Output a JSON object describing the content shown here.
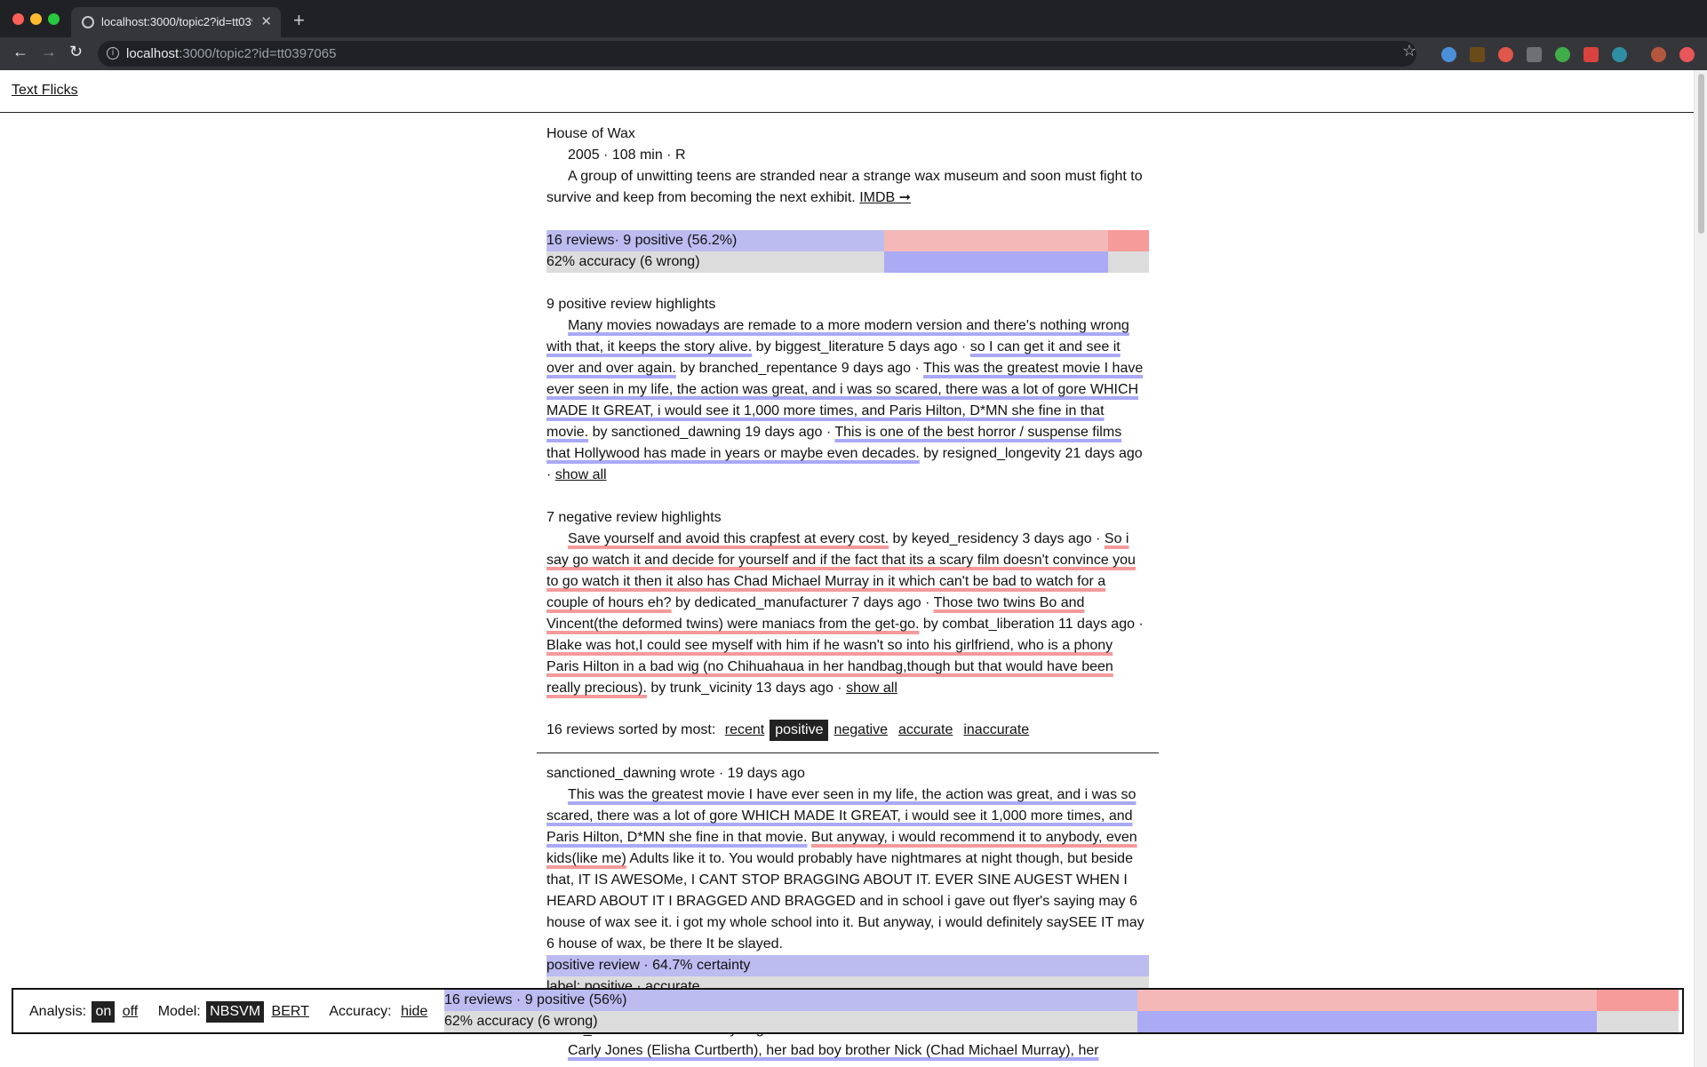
{
  "browser": {
    "tab_title": "localhost:3000/topic2?id=tt0397065",
    "url_host": "localhost",
    "url_rest": ":3000/topic2?id=tt0397065"
  },
  "site": {
    "brand": "Text Flicks"
  },
  "movie": {
    "title": "House of Wax",
    "meta": "2005 · 108 min · R",
    "synopsis": "A group of unwitting teens are stranded near a strange wax museum and soon must fight to survive and keep from becoming the next exhibit.",
    "imdb_link": "IMDB ➞"
  },
  "summary": {
    "reviews_line": "16 reviews· 9 positive (56.2%)",
    "accuracy_line": "62% accuracy (6 wrong)",
    "positive_share": 0.562,
    "accuracy": 0.62
  },
  "positive_highlights": {
    "heading": "9 positive review highlights",
    "items": [
      {
        "text": "Many movies nowadays are remade to a more modern version and there's nothing wrong with that, it keeps the story alive.",
        "byline": "by biggest_literature 5 days ago"
      },
      {
        "text": "so I can get it and see it over and over again.",
        "byline": "by branched_repentance 9 days ago"
      },
      {
        "text": "This was the greatest movie I have ever seen in my life, the action was great, and i was so scared, there was a lot of gore WHICH MADE It GREAT, i would see it 1,000 more times, and Paris Hilton, D*MN she fine in that movie.",
        "byline": "by sanctioned_dawning 19 days ago"
      },
      {
        "text": "This is one of the best horror / suspense films that Hollywood has made in years or maybe even decades.",
        "byline": "by resigned_longevity 21 days ago"
      }
    ],
    "show_all": "show all"
  },
  "negative_highlights": {
    "heading": "7 negative review highlights",
    "items": [
      {
        "text": "Save yourself and avoid this crapfest at every cost.",
        "byline": "by keyed_residency 3 days ago"
      },
      {
        "text": "So i say go watch it and decide for yourself and if the fact that its a scary film doesn't convince you to go watch it then it also has Chad Michael Murray in it which can't be bad to watch for a couple of hours eh?",
        "byline": "by dedicated_manufacturer 7 days ago"
      },
      {
        "text": "Those two twins Bo and Vincent(the deformed twins) were maniacs from the get-go.",
        "byline": "by combat_liberation 11 days ago"
      },
      {
        "text": "Blake was hot,I could see myself with him if he wasn't so into his girlfriend, who is a phony Paris Hilton in a bad wig (no Chihuahaua in her handbag,though but that would have been really precious).",
        "byline": "by trunk_vicinity 13 days ago"
      }
    ],
    "show_all": "show all"
  },
  "sort": {
    "label": "16 reviews sorted by most:",
    "options": [
      "recent",
      "positive",
      "negative",
      "accurate",
      "inaccurate"
    ],
    "active": "positive"
  },
  "review": {
    "header": "sanctioned_dawning wrote · 19 days ago",
    "pos_part": "This was the greatest movie I have ever seen in my life, the action was great, and i was so scared, there was a lot of gore WHICH MADE It GREAT, i would see it 1,000 more times, and Paris Hilton, D*MN she fine in that movie.",
    "neg_part": "But anyway, i would recommend it to anybody, even kids(like me)",
    "rest": "Adults like it to. You would probably have nightmares at night though, but beside that, IT IS AWESOMe, I CANT STOP BRAGGING ABOUT IT. EVER SINE AUGEST WHEN I HEARD ABOUT IT I BRAGGED AND BRAGGED and in school i gave out flyer's saying may 6 house of wax see it. i got my whole school into it. But anyway, i would definitely saySEE IT may 6 house of wax, be there It be slayed.",
    "verdict": "positive review · 64.7% certainty",
    "label_line": "label: positive · accurate",
    "next_header_partial": "elisha_cuthbert wrote · 20 days ago",
    "next_pos": "Carly Jones (Elisha Curtberth), her bad boy brother Nick (Chad Michael Murray), her"
  },
  "panel": {
    "analysis_label": "Analysis:",
    "analysis_on": "on",
    "analysis_off": "off",
    "model_label": "Model:",
    "model_nbsvm": "NBSVM",
    "model_bert": "BERT",
    "accuracy_label": "Accuracy:",
    "accuracy_hide": "hide",
    "reviews_line": "16 reviews · 9 positive (56%)",
    "accuracy_line": "62% accuracy (6 wrong)"
  },
  "colors": {
    "positive": "#bcbcf1",
    "negative": "#f4b8b8",
    "negative_strong": "#f79a9a",
    "wrong": "#aaaaf5",
    "neutral": "#dcdcdc"
  }
}
